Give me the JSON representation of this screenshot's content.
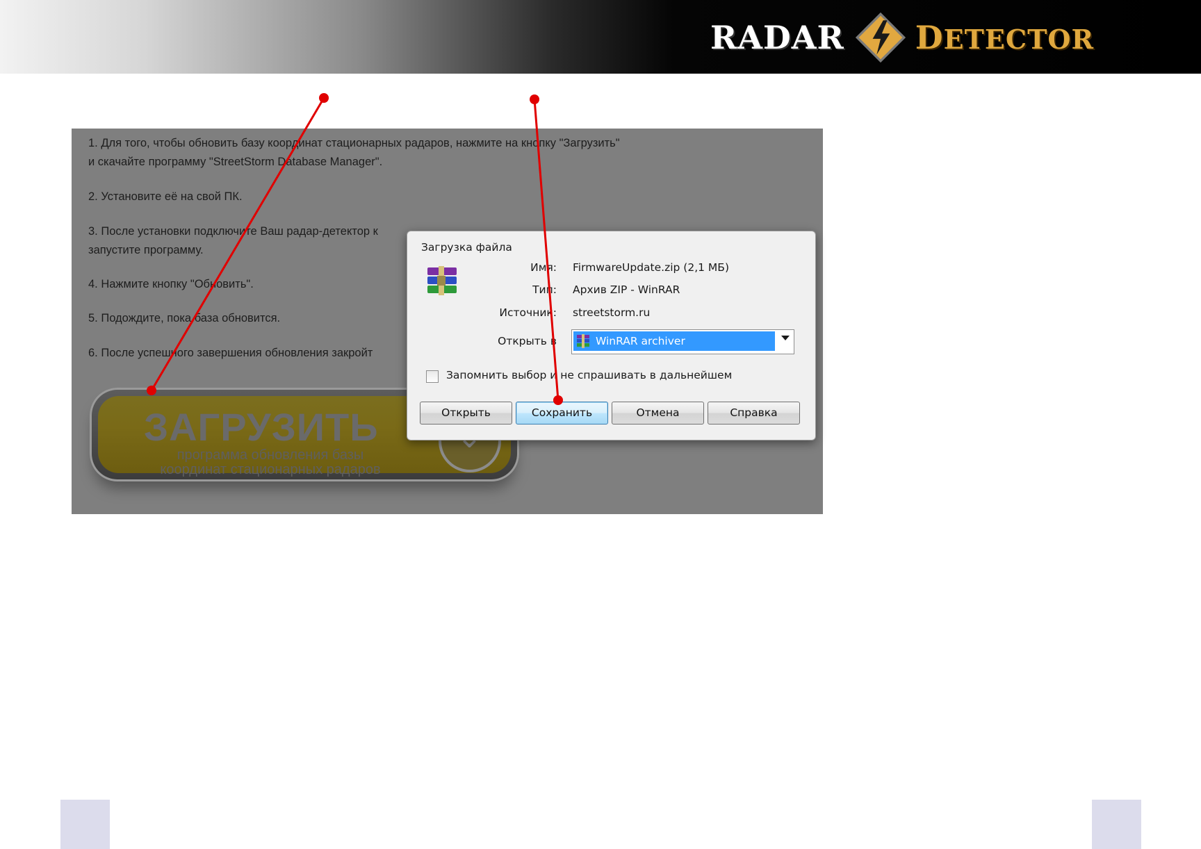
{
  "header": {
    "logo_left": "RADAR",
    "logo_right_initial": "D",
    "logo_right_rest": "ETECTOR",
    "logo_icon": "lightning-diamond-icon"
  },
  "instructions": {
    "step1_line1": "1. Для того, чтобы обновить базу координат стационарных радаров, нажмите на кнопку \"Загрузить\"",
    "step1_line2": "и скачайте программу \"StreetStorm Database Manager\".",
    "step2": "2. Установите её на свой ПК.",
    "step3_line1": "3. После установки подключите Ваш радар-детектор к",
    "step3_line2": "запустите программу.",
    "step4": "4. Нажмите кнопку \"Обновить\".",
    "step5": "5. Подождите, пока база обновится.",
    "step6": "6. После успешного завершения обновления закройт"
  },
  "download_button": {
    "title": "ЗАГРУЗИТЬ",
    "subtitle_line1": "программа обновления базы",
    "subtitle_line2": "координат стационарных радаров"
  },
  "dialog": {
    "title": "Загрузка файла",
    "name_label": "Имя:",
    "name_value": "FirmwareUpdate.zip (2,1 МБ)",
    "type_label": "Тип:",
    "type_value": "Архив ZIP - WinRAR",
    "source_label": "Источник:",
    "source_value": "streetstorm.ru",
    "open_with_label": "Открыть в",
    "open_with_value": "WinRAR archiver",
    "remember_label": "Запомнить выбор и не спрашивать в дальнейшем",
    "remember_checked": false,
    "buttons": {
      "open": "Открыть",
      "save": "Сохранить",
      "cancel": "Отмена",
      "help": "Справка"
    }
  },
  "colors": {
    "accent_gold": "#e0a83e",
    "annotation_red": "#e00000",
    "selection_blue": "#3399ff"
  }
}
